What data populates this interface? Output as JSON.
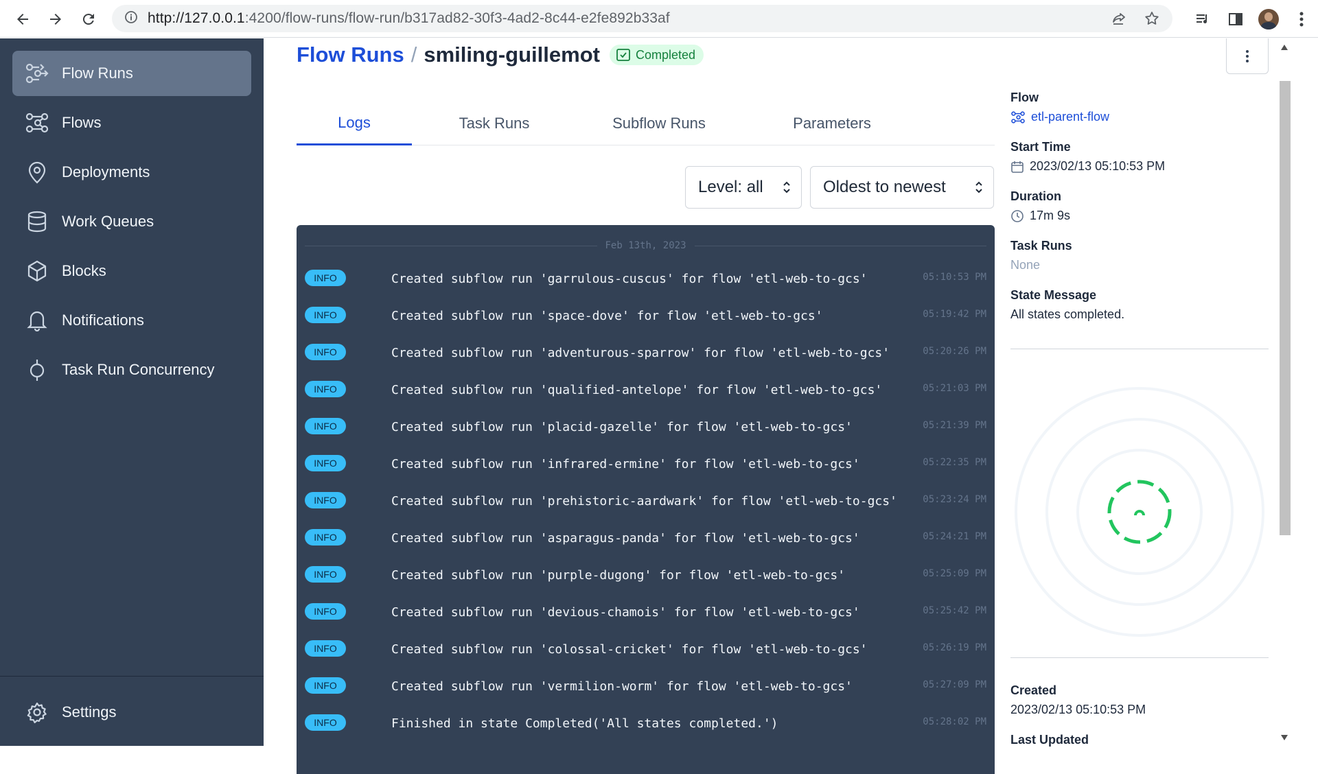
{
  "browser": {
    "url_host": "http://127.0.0.1",
    "url_path": ":4200/flow-runs/flow-run/b317ad82-30f3-4ad2-8c44-e2fe892b33af"
  },
  "sidebar": {
    "items": [
      {
        "label": "Flow Runs",
        "icon": "flow-runs-icon",
        "active": true
      },
      {
        "label": "Flows",
        "icon": "flows-icon"
      },
      {
        "label": "Deployments",
        "icon": "map-pin-icon"
      },
      {
        "label": "Work Queues",
        "icon": "database-icon"
      },
      {
        "label": "Blocks",
        "icon": "cube-icon"
      },
      {
        "label": "Notifications",
        "icon": "bell-icon"
      },
      {
        "label": "Task Run Concurrency",
        "icon": "concurrency-icon"
      }
    ],
    "settings_label": "Settings"
  },
  "header": {
    "breadcrumb_root": "Flow Runs",
    "separator": "/",
    "run_name": "smiling-guillemot",
    "state": "Completed",
    "state_color": "#15803d"
  },
  "tabs": [
    "Logs",
    "Task Runs",
    "Subflow Runs",
    "Parameters"
  ],
  "filters": {
    "level": "Level: all",
    "sort": "Oldest to newest"
  },
  "logs": {
    "date": "Feb 13th, 2023",
    "entries": [
      {
        "level": "INFO",
        "message": "Created subflow run 'garrulous-cuscus' for flow 'etl-web-to-gcs'",
        "time": "05:10:53 PM"
      },
      {
        "level": "INFO",
        "message": "Created subflow run 'space-dove' for flow 'etl-web-to-gcs'",
        "time": "05:19:42 PM"
      },
      {
        "level": "INFO",
        "message": "Created subflow run 'adventurous-sparrow' for flow 'etl-web-to-gcs'",
        "time": "05:20:26 PM"
      },
      {
        "level": "INFO",
        "message": "Created subflow run 'qualified-antelope' for flow 'etl-web-to-gcs'",
        "time": "05:21:03 PM"
      },
      {
        "level": "INFO",
        "message": "Created subflow run 'placid-gazelle' for flow 'etl-web-to-gcs'",
        "time": "05:21:39 PM"
      },
      {
        "level": "INFO",
        "message": "Created subflow run 'infrared-ermine' for flow 'etl-web-to-gcs'",
        "time": "05:22:35 PM"
      },
      {
        "level": "INFO",
        "message": "Created subflow run 'prehistoric-aardwark' for flow 'etl-web-to-gcs'",
        "time": "05:23:24 PM"
      },
      {
        "level": "INFO",
        "message": "Created subflow run 'asparagus-panda' for flow 'etl-web-to-gcs'",
        "time": "05:24:21 PM"
      },
      {
        "level": "INFO",
        "message": "Created subflow run 'purple-dugong' for flow 'etl-web-to-gcs'",
        "time": "05:25:09 PM"
      },
      {
        "level": "INFO",
        "message": "Created subflow run 'devious-chamois' for flow 'etl-web-to-gcs'",
        "time": "05:25:42 PM"
      },
      {
        "level": "INFO",
        "message": "Created subflow run 'colossal-cricket' for flow 'etl-web-to-gcs'",
        "time": "05:26:19 PM"
      },
      {
        "level": "INFO",
        "message": "Created subflow run 'vermilion-worm' for flow 'etl-web-to-gcs'",
        "time": "05:27:09 PM"
      },
      {
        "level": "INFO",
        "message": "Finished in state Completed('All states completed.')",
        "time": "05:28:02 PM"
      }
    ]
  },
  "details": {
    "flow_label": "Flow",
    "flow_value": "etl-parent-flow",
    "start_time_label": "Start Time",
    "start_time_value": "2023/02/13 05:10:53 PM",
    "duration_label": "Duration",
    "duration_value": "17m 9s",
    "task_runs_label": "Task Runs",
    "task_runs_value": "None",
    "state_message_label": "State Message",
    "state_message_value": "All states completed.",
    "created_label": "Created",
    "created_value": "2023/02/13 05:10:53 PM",
    "last_updated_label": "Last Updated"
  },
  "colors": {
    "sidebar_bg": "#334155",
    "accent": "#1d4ed8",
    "log_bg": "#334155",
    "info_badge": "#38bdf8",
    "success": "#22c55e"
  }
}
